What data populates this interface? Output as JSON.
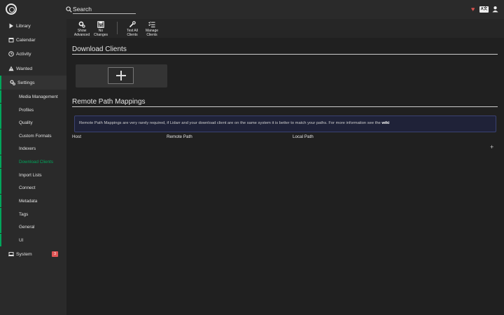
{
  "header": {
    "search_placeholder": "Search",
    "heart_glyph": "♥",
    "lang_label": "A文"
  },
  "sidebar": {
    "items": [
      {
        "label": "Library",
        "icon": "play-icon"
      },
      {
        "label": "Calendar",
        "icon": "calendar-icon"
      },
      {
        "label": "Activity",
        "icon": "clock-icon"
      },
      {
        "label": "Wanted",
        "icon": "warning-icon"
      },
      {
        "label": "Settings",
        "icon": "gears-icon"
      },
      {
        "label": "System",
        "icon": "laptop-icon",
        "badge": "3"
      }
    ],
    "settings_children": [
      "Media Management",
      "Profiles",
      "Quality",
      "Custom Formats",
      "Indexers",
      "Download Clients",
      "Import Lists",
      "Connect",
      "Metadata",
      "Tags",
      "General",
      "UI"
    ]
  },
  "toolbar": {
    "show_advanced": [
      "Show",
      "Advanced"
    ],
    "no_changes": [
      "No",
      "Changes"
    ],
    "test_all": [
      "Test All",
      "Clients"
    ],
    "manage": [
      "Manage",
      "Clients"
    ]
  },
  "main": {
    "download_clients_title": "Download Clients",
    "remote_path_title": "Remote Path Mappings",
    "info_text": "Remote Path Mappings are very rarely required, if Lidarr and your download client are on the same system it is better to match your paths. For more information see the ",
    "info_link": "wiki",
    "columns": [
      "Host",
      "Remote Path",
      "Local Path"
    ],
    "add_glyph": "+"
  },
  "colors": {
    "accent": "#00a65b",
    "badge": "#e05555",
    "heart": "#d9534f",
    "info_bg": "#1f2238"
  }
}
